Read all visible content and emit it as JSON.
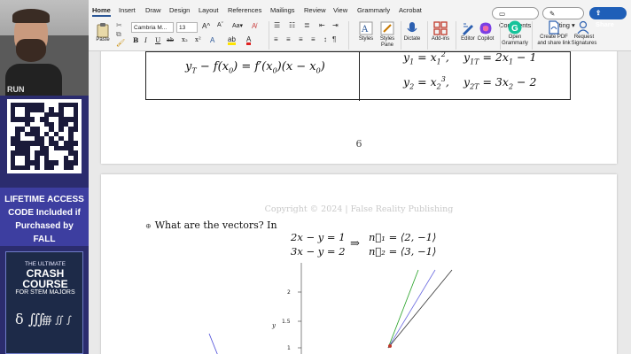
{
  "sidebar": {
    "webcam_label": "RUN",
    "promo_text": "LIFETIME ACCESS CODE Included if Purchased by FALL",
    "book": {
      "line1": "THE ULTIMATE",
      "line2": "CRASH COURSE",
      "line3": "FOR STEM MAJORS",
      "symbols": "δ ∭",
      "symbols2": "∰ ∬ ∫"
    }
  },
  "ribbon": {
    "tabs": [
      "Home",
      "Insert",
      "Draw",
      "Design",
      "Layout",
      "References",
      "Mailings",
      "Review",
      "View",
      "Grammarly",
      "Acrobat"
    ],
    "active_tab": "Home",
    "comments_label": "Comments",
    "editing_label": "Editing",
    "share_label": "Share",
    "paste_label": "Paste",
    "font_name": "Cambria M...",
    "font_size": "13",
    "format_buttons": [
      "B",
      "I",
      "U",
      "ab",
      "x₂",
      "x²"
    ],
    "tools": [
      {
        "id": "styles",
        "label": "Styles"
      },
      {
        "id": "styles-pane",
        "label": "Styles Pane"
      },
      {
        "id": "dictate",
        "label": "Dictate"
      },
      {
        "id": "add-ins",
        "label": "Add-ins"
      },
      {
        "id": "editor",
        "label": "Editor"
      },
      {
        "id": "copilot",
        "label": "Copilot"
      },
      {
        "id": "open-grammarly",
        "label": "Open Grammarly"
      },
      {
        "id": "create-pdf",
        "label": "Create PDF and share link"
      },
      {
        "id": "request-signatures",
        "label": "Request Signatures"
      }
    ],
    "colors": {
      "accent": "#2b5797",
      "share_bg": "#1f5fb8",
      "copilot": "#7b3fe4",
      "grammarly": "#15c39a"
    }
  },
  "page1": {
    "left_equation": "y_T − f(x₀) = f′(x₀)(x − x₀)",
    "right_rows": [
      {
        "y": "y₁ = x₁²,",
        "tangent": "y₁T = 2x₁ − 1"
      },
      {
        "y": "y₂ = x₂³,",
        "tangent": "y₂T = 3x₂ − 2"
      }
    ],
    "page_number": "6"
  },
  "page2": {
    "watermark": "Copyright © 2024 | False Reality Publishing",
    "question": "What are the vectors? In",
    "system": [
      "2x − y = 1",
      "3x − y = 2"
    ],
    "implies": "⇒",
    "vectors": [
      "n⃗₁ = ⟨2, −1⟩",
      "n⃗₂ = ⟨3, −1⟩"
    ],
    "graph": {
      "y_ticks": [
        "2",
        "1.5",
        "1"
      ],
      "y_label": "y",
      "line_colors": [
        "#4a4ad8",
        "#22a022",
        "#6a6ae0",
        "#333333"
      ]
    }
  }
}
